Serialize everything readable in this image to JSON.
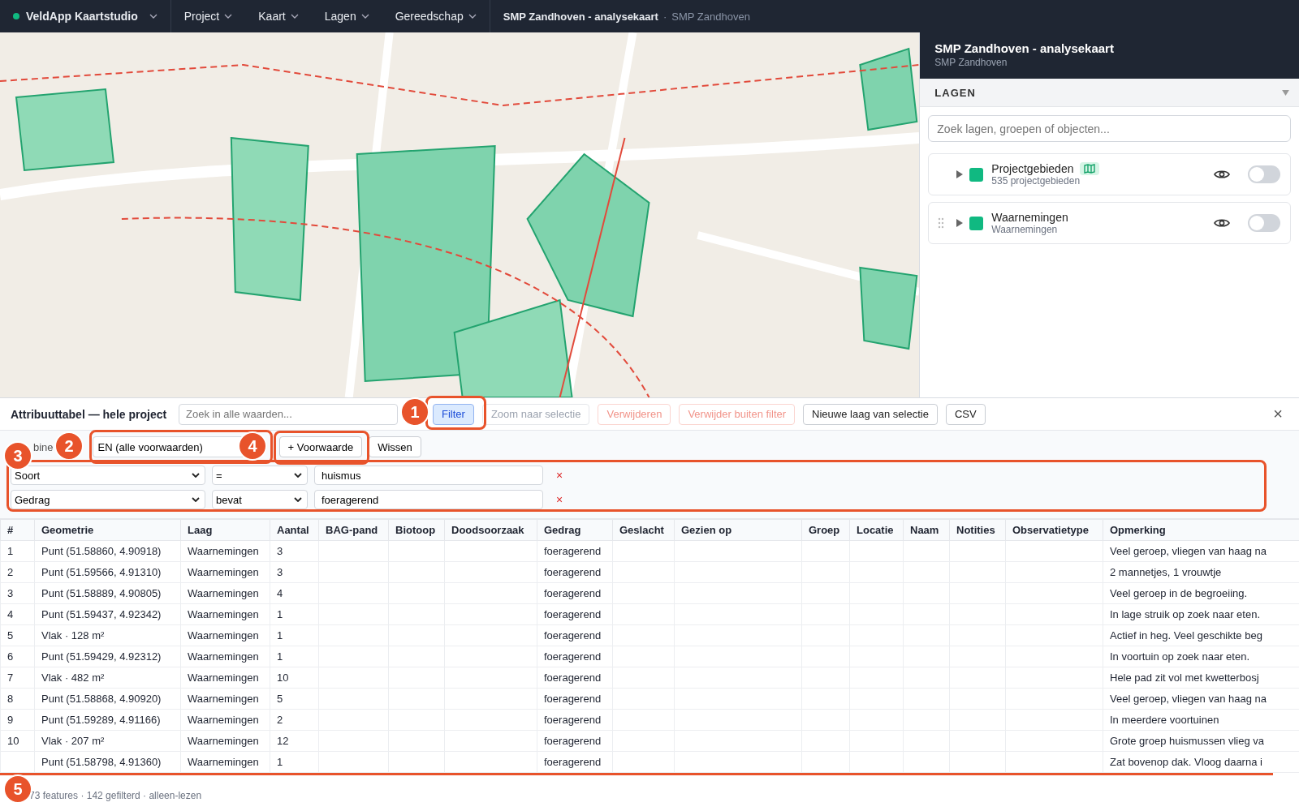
{
  "topbar": {
    "brand": "VeldApp Kaartstudio",
    "menus": [
      "Project",
      "Kaart",
      "Lagen",
      "Gereedschap"
    ],
    "title": "SMP Zandhoven - analysekaart",
    "separator": "·",
    "subtitle": "SMP Zandhoven"
  },
  "panel": {
    "title": "SMP Zandhoven - analysekaart",
    "subtitle": "SMP Zandhoven",
    "section": "LAGEN",
    "expanded": true,
    "search": {
      "placeholder": "Zoek lagen, groepen of objecten..."
    },
    "layers": [
      {
        "name": "Projectgebieden",
        "subtitle": "535 projectgebieden",
        "color": "#10b981",
        "map_badge": true,
        "draggable": false,
        "on": false
      },
      {
        "name": "Waarnemingen",
        "subtitle": "Waarnemingen",
        "color": "#10b981",
        "map_badge": false,
        "draggable": true,
        "on": false
      }
    ]
  },
  "table_panel": {
    "title": "Attribuuttabel — hele project",
    "search": {
      "placeholder": "Zoek in alle waarden..."
    },
    "buttons": [
      {
        "label": "Filter",
        "selected": true,
        "disabled": false,
        "danger": false
      },
      {
        "label": "Zoom naar selectie",
        "selected": false,
        "disabled": true,
        "danger": false
      },
      {
        "label": "Verwijderen",
        "selected": false,
        "disabled": true,
        "danger": true
      },
      {
        "label": "Verwijder buiten filter",
        "selected": false,
        "disabled": true,
        "danger": true
      },
      {
        "label": "Nieuwe laag van selectie",
        "selected": false,
        "disabled": false,
        "danger": false
      },
      {
        "label": "CSV",
        "selected": false,
        "disabled": false,
        "danger": false
      }
    ],
    "close": "×",
    "filter": {
      "combine_label": "bine",
      "combine": "EN (alle voorwaarden)",
      "add": "+ Voorwaarde",
      "clear": "Wissen",
      "conditions": [
        {
          "field": "Soort",
          "operator": "=",
          "value": "huismus",
          "remove": "×"
        },
        {
          "field": "Gedrag",
          "operator": "bevat",
          "value": "foeragerend",
          "remove": "×"
        }
      ]
    },
    "columns": [
      "#",
      "Geometrie",
      "Laag",
      "Aantal",
      "BAG-pand",
      "Biotoop",
      "Doodsoorzaak",
      "Gedrag",
      "Geslacht",
      "Gezien op",
      "Groep",
      "Locatie",
      "Naam",
      "Notities",
      "Observatietype",
      "Opmerking"
    ],
    "rows": [
      {
        "num": "1",
        "geometrie": "Punt (51.58860, 4.90918)",
        "laag": "Waarnemingen",
        "aantal": "3",
        "gedrag": "foeragerend",
        "opmerking": "Veel geroep, vliegen van haag na"
      },
      {
        "num": "2",
        "geometrie": "Punt (51.59566, 4.91310)",
        "laag": "Waarnemingen",
        "aantal": "3",
        "gedrag": "foeragerend",
        "opmerking": "2 mannetjes, 1 vrouwtje"
      },
      {
        "num": "3",
        "geometrie": "Punt (51.58889, 4.90805)",
        "laag": "Waarnemingen",
        "aantal": "4",
        "gedrag": "foeragerend",
        "opmerking": "Veel geroep in de begroeiing."
      },
      {
        "num": "4",
        "geometrie": "Punt (51.59437, 4.92342)",
        "laag": "Waarnemingen",
        "aantal": "1",
        "gedrag": "foeragerend",
        "opmerking": "In lage struik op zoek naar eten."
      },
      {
        "num": "5",
        "geometrie": "Vlak · 128 m²",
        "laag": "Waarnemingen",
        "aantal": "1",
        "gedrag": "foeragerend",
        "opmerking": "Actief in heg. Veel geschikte beg"
      },
      {
        "num": "6",
        "geometrie": "Punt (51.59429, 4.92312)",
        "laag": "Waarnemingen",
        "aantal": "1",
        "gedrag": "foeragerend",
        "opmerking": "In voortuin op zoek naar eten."
      },
      {
        "num": "7",
        "geometrie": "Vlak · 482 m²",
        "laag": "Waarnemingen",
        "aantal": "10",
        "gedrag": "foeragerend",
        "opmerking": "Hele pad zit vol met kwetterbosj"
      },
      {
        "num": "8",
        "geometrie": "Punt (51.58868, 4.90920)",
        "laag": "Waarnemingen",
        "aantal": "5",
        "gedrag": "foeragerend",
        "opmerking": "Veel geroep, vliegen van haag na"
      },
      {
        "num": "9",
        "geometrie": "Punt (51.59289, 4.91166)",
        "laag": "Waarnemingen",
        "aantal": "2",
        "gedrag": "foeragerend",
        "opmerking": "In meerdere voortuinen"
      },
      {
        "num": "10",
        "geometrie": "Vlak · 207 m²",
        "laag": "Waarnemingen",
        "aantal": "12",
        "gedrag": "foeragerend",
        "opmerking": "Grote groep huismussen vlieg va"
      },
      {
        "geometrie": "Punt (51.58798, 4.91360)",
        "laag": "Waarnemingen",
        "aantal": "1",
        "gedrag": "foeragerend",
        "opmerking": "Zat bovenop dak. Vloog daarna i"
      }
    ],
    "status": "73 features · 142 gefilterd · alleen-lezen"
  },
  "annotations": [
    {
      "label": "1"
    },
    {
      "label": "2"
    },
    {
      "label": "3"
    },
    {
      "label": "4"
    },
    {
      "label": "5"
    }
  ]
}
